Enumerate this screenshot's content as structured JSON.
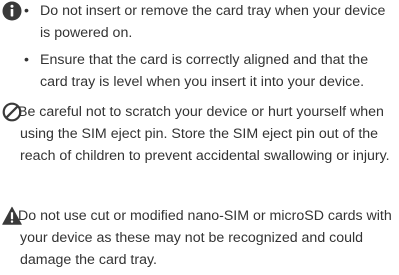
{
  "notices": {
    "caution": {
      "icon": "info-circle-icon",
      "icon_color": "#3a3a3a",
      "bullets": [
        "Do not insert or remove the card tray when your device is powered on.",
        "Ensure that the card is correctly aligned and that the card tray is level when you insert it into your device."
      ]
    },
    "prohibited": {
      "icon": "prohibited-circle-icon",
      "icon_color": "#3a3a3a",
      "text": "Be careful not to scratch your device or hurt yourself when using the SIM eject pin. Store the SIM eject pin out of the reach of children to prevent accidental swallowing or injury."
    },
    "warning": {
      "icon": "warning-triangle-icon",
      "icon_color": "#3a3a3a",
      "text": "Do not use cut or modified nano-SIM or microSD cards with your device as these may not be recognized and could damage the card tray."
    }
  }
}
